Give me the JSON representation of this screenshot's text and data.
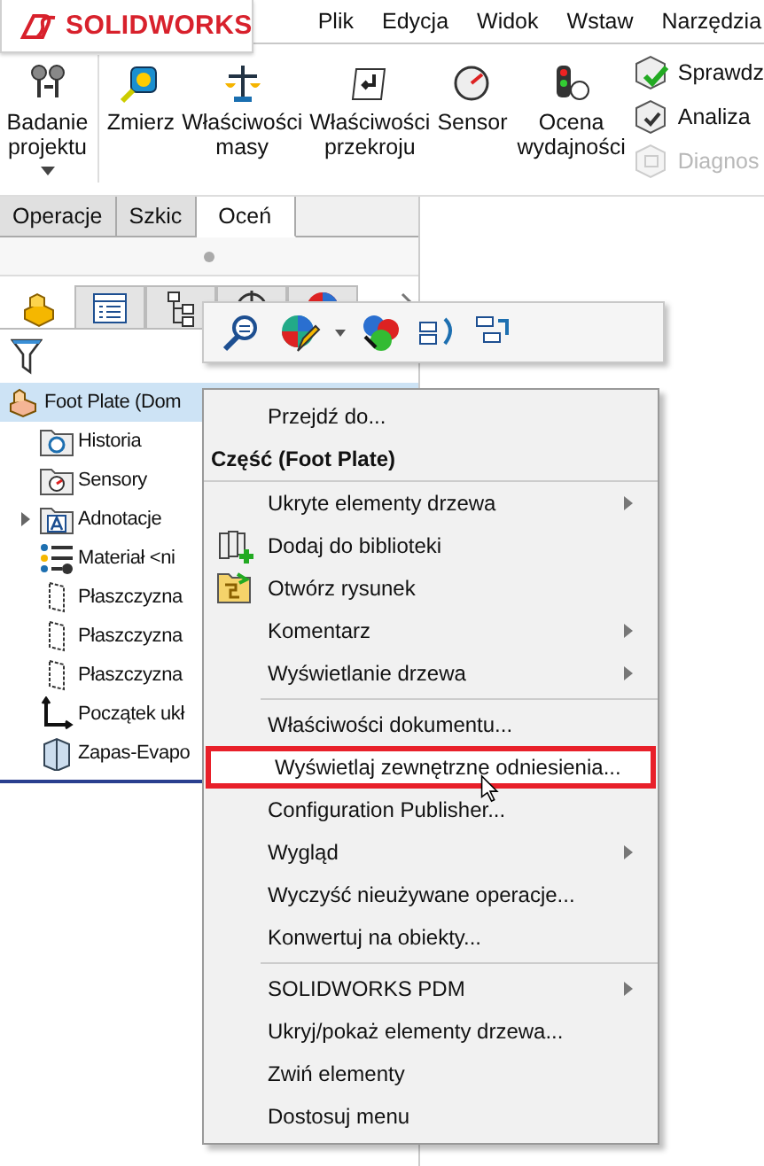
{
  "app": {
    "logo": "SOLIDWORKS"
  },
  "menu_bar": [
    "Plik",
    "Edycja",
    "Widok",
    "Wstaw",
    "Narzędzia"
  ],
  "ribbon": {
    "buttons": [
      {
        "kind": "design-study",
        "label": "Badanie projektu",
        "dropdown": true
      },
      {
        "kind": "measure",
        "label": "Zmierz",
        "dropdown": false
      },
      {
        "kind": "mass",
        "label": "Właściwości masy",
        "dropdown": false
      },
      {
        "kind": "section",
        "label": "Właściwości przekroju",
        "dropdown": false
      },
      {
        "kind": "sensor",
        "label": "Sensor",
        "dropdown": false
      },
      {
        "kind": "performance",
        "label": "Ocena wydajności",
        "dropdown": false
      }
    ],
    "stack": [
      {
        "label": "Sprawdz",
        "disabled": false,
        "kind": "check-green"
      },
      {
        "label": "Analiza",
        "disabled": false,
        "kind": "check"
      },
      {
        "label": "Diagnos",
        "disabled": true,
        "kind": "diag"
      }
    ]
  },
  "tabs": [
    {
      "label": "Operacje",
      "selected": false
    },
    {
      "label": "Szkic",
      "selected": false
    },
    {
      "label": "Oceń",
      "selected": true
    }
  ],
  "panel_tabs": [
    {
      "kind": "part",
      "selected": true
    },
    {
      "kind": "property",
      "selected": false
    },
    {
      "kind": "config",
      "selected": false
    },
    {
      "kind": "dim",
      "selected": false
    },
    {
      "kind": "display",
      "selected": false
    }
  ],
  "tree": {
    "root": {
      "label": "Foot Plate  (Dom",
      "selected": true
    },
    "items": [
      {
        "kind": "history",
        "label": "Historia",
        "expander": false
      },
      {
        "kind": "sensors",
        "label": "Sensory",
        "expander": false
      },
      {
        "kind": "annotations",
        "label": "Adnotacje",
        "expander": true
      },
      {
        "kind": "material",
        "label": "Materiał <ni",
        "expander": false
      },
      {
        "kind": "plane",
        "label": "Płaszczyzna",
        "expander": false
      },
      {
        "kind": "plane",
        "label": "Płaszczyzna",
        "expander": false
      },
      {
        "kind": "plane",
        "label": "Płaszczyzna",
        "expander": false
      },
      {
        "kind": "origin",
        "label": "Początek ukł",
        "expander": false
      },
      {
        "kind": "stock",
        "label": "Zapas-Evapo",
        "expander": false
      }
    ]
  },
  "context_menu": [
    {
      "kind": "item",
      "label": "Przejdź do...",
      "submenu": false,
      "selected": false
    },
    {
      "kind": "header",
      "label": "Część (Foot Plate)"
    },
    {
      "kind": "item",
      "label": "Ukryte elementy drzewa",
      "submenu": true,
      "selected": false
    },
    {
      "kind": "library",
      "label": "Dodaj do biblioteki",
      "submenu": false,
      "selected": false
    },
    {
      "kind": "drawing",
      "label": "Otwórz rysunek",
      "submenu": false,
      "selected": false
    },
    {
      "kind": "item",
      "label": "Komentarz",
      "submenu": true,
      "selected": false
    },
    {
      "kind": "item",
      "label": "Wyświetlanie drzewa",
      "submenu": true,
      "selected": false
    },
    {
      "kind": "separator"
    },
    {
      "kind": "item",
      "label": "Właściwości dokumentu...",
      "submenu": false,
      "selected": false
    },
    {
      "kind": "item",
      "label": "Wyświetlaj zewnętrzne odniesienia...",
      "submenu": false,
      "selected": true
    },
    {
      "kind": "item",
      "label": "Configuration Publisher...",
      "submenu": false,
      "selected": false
    },
    {
      "kind": "item",
      "label": "Wygląd",
      "submenu": true,
      "selected": false
    },
    {
      "kind": "item",
      "label": "Wyczyść nieużywane operacje...",
      "submenu": false,
      "selected": false
    },
    {
      "kind": "item",
      "label": "Konwertuj na obiekty...",
      "submenu": false,
      "selected": false
    },
    {
      "kind": "separator"
    },
    {
      "kind": "item",
      "label": "SOLIDWORKS PDM",
      "submenu": true,
      "selected": false
    },
    {
      "kind": "item",
      "label": "Ukryj/pokaż elementy drzewa...",
      "submenu": false,
      "selected": false
    },
    {
      "kind": "item",
      "label": "Zwiń elementy",
      "submenu": false,
      "selected": false
    },
    {
      "kind": "item",
      "label": "Dostosuj menu",
      "submenu": false,
      "selected": false
    }
  ]
}
